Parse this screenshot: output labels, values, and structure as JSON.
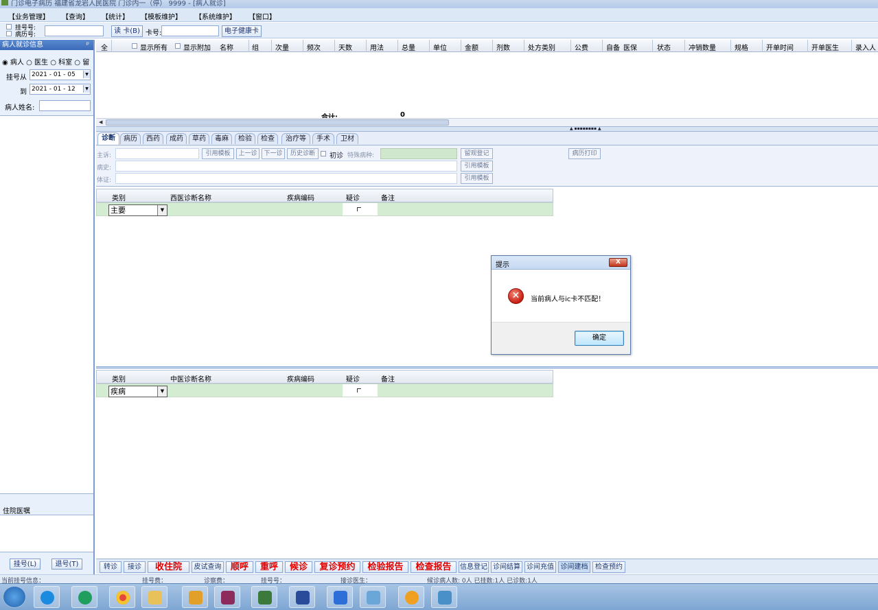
{
  "titlebar": {
    "title": "门诊电子病历 福建省龙岩人民医院 门诊内一（停） 9999 - [病人就诊]"
  },
  "menu": [
    "【业务管理】",
    "【查询】",
    "【统计】",
    "【模板维护】",
    "【系统维护】",
    "【窗口】"
  ],
  "toolbar": {
    "reg_no_label": "挂号号:",
    "record_no_label": "病历号:",
    "read_card": "读 卡(B)",
    "card_no_label": "卡号:",
    "ehealth_card": "电子健康卡"
  },
  "left_panel": {
    "header": "病人就诊信息",
    "pin": "ᵖ",
    "radios": [
      "病人",
      "医生",
      "科室",
      "留"
    ],
    "from_label": "挂号从",
    "from_date": "2021 - 01 - 05",
    "to_label": "到",
    "to_date": "2021 - 01 - 12",
    "name_label": "病人姓名:",
    "inpatient_header": "住院医嘱",
    "register_btn": "挂号(L)",
    "unregister_btn": "退号(T)"
  },
  "prescription_grid": {
    "all_label": "全",
    "show_all": "显示所有",
    "show_extra": "显示附加",
    "columns": [
      "名称",
      "组",
      "次量",
      "频次",
      "天数",
      "用法",
      "总量",
      "单位",
      "金额",
      "剂数",
      "处方类别",
      "公费",
      "自备",
      "医保",
      "状态",
      "冲销数量",
      "规格",
      "开单时间",
      "开单医生",
      "录入人"
    ],
    "total_label": "合计:",
    "total_value": "0"
  },
  "tabs": [
    "诊断",
    "病历",
    "西药",
    "成药",
    "草药",
    "毒麻",
    "检验",
    "检查",
    "治疗等",
    "手术",
    "卫材"
  ],
  "form": {
    "complaint_label": "主诉:",
    "history_label": "病史:",
    "sign_label": "体证:",
    "cite_template": "引用模板",
    "prev_visit": "上一诊",
    "next_visit": "下一诊",
    "history_diag": "历史诊断",
    "first_visit": "初诊",
    "special_disease_label": "特殊病种:",
    "observe_reg": "留观登记",
    "print_record": "病历打印"
  },
  "western_diag": {
    "columns": [
      "类别",
      "西医诊断名称",
      "疾病编码",
      "疑诊",
      "备注"
    ],
    "row_type": "主要"
  },
  "tcm_diag": {
    "columns": [
      "类别",
      "中医诊断名称",
      "疾病编码",
      "疑诊",
      "备注"
    ],
    "row_type": "疾病"
  },
  "dialog": {
    "title": "提示",
    "close": "X",
    "message": "当前病人与ic卡不匹配！",
    "ok": "确定"
  },
  "bottom_buttons": [
    {
      "label": "转诊",
      "style": "normal"
    },
    {
      "label": "接诊",
      "style": "normal"
    },
    {
      "label": "收住院",
      "style": "red"
    },
    {
      "label": "皮试查询",
      "style": "normal"
    },
    {
      "label": "顺呼",
      "style": "red"
    },
    {
      "label": "重呼",
      "style": "red"
    },
    {
      "label": "候诊",
      "style": "red"
    },
    {
      "label": "复诊预约",
      "style": "red"
    },
    {
      "label": "检验报告",
      "style": "red"
    },
    {
      "label": "检查报告",
      "style": "red"
    },
    {
      "label": "信息登记",
      "style": "normal"
    },
    {
      "label": "诊间结算",
      "style": "normal"
    },
    {
      "label": "诊间充值",
      "style": "normal"
    },
    {
      "label": "诊间建档",
      "style": "normal"
    },
    {
      "label": "检查预约",
      "style": "normal"
    }
  ],
  "status": {
    "current_reg": "当前挂号信息：",
    "reg_fee": "挂号费：",
    "exam_fee": "诊察费：",
    "reg_no": "挂号号：",
    "doctor": "接诊医生：",
    "waiting": "候诊病人数: 0人  已挂数:1人  已诊数:1人"
  },
  "taskbar": {
    "apps": [
      "start-orb",
      "ie",
      "edge",
      "chrome",
      "explorer",
      "sql-server",
      "archive",
      "monitor",
      "sql-tool",
      "wps",
      "notepad",
      "search",
      "image-viewer"
    ],
    "colors": [
      "#2f6fc0",
      "#1b8be0",
      "#1f9e5d",
      "#e8453c",
      "#e8c15a",
      "#e0a02a",
      "#8d2b5c",
      "#3b7a3b",
      "#2a4a9a",
      "#2d6fd6",
      "#6aa6d8",
      "#f0a020",
      "#4a90c8"
    ]
  }
}
